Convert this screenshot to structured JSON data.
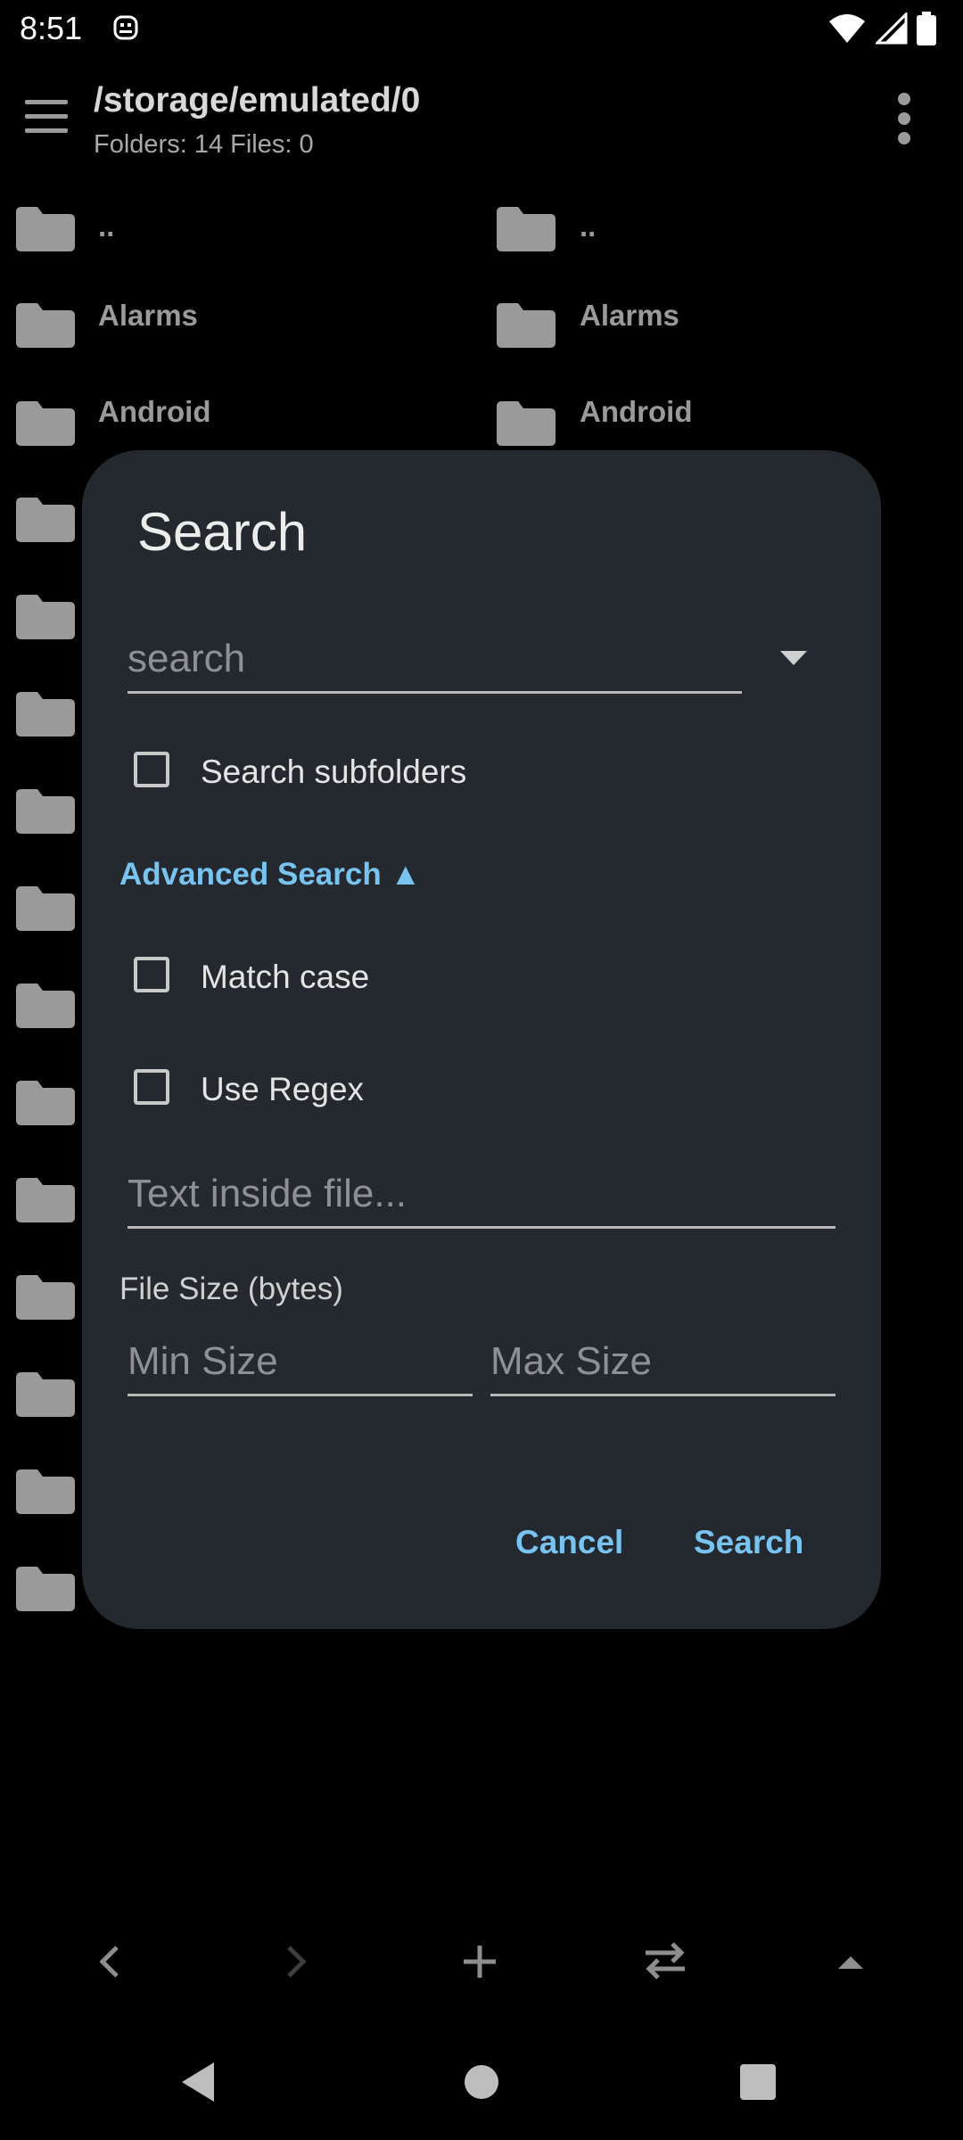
{
  "status_bar": {
    "time": "8:51",
    "icons": [
      "app-notification-icon",
      "wifi-icon",
      "signal-icon",
      "battery-icon"
    ]
  },
  "app_bar": {
    "path": "/storage/emulated/0",
    "summary": "Folders: 14 Files: 0",
    "icons": [
      "menu-icon",
      "more-vert-icon"
    ]
  },
  "file_list": {
    "rows": [
      {
        "left": "..",
        "right": ".."
      },
      {
        "left": "Alarms",
        "right": "Alarms"
      },
      {
        "left": "Android",
        "right": "Android"
      }
    ],
    "extra_folder_icons": 12
  },
  "dialog": {
    "title": "Search",
    "search_placeholder": "search",
    "search_subfolders_label": "Search subfolders",
    "search_subfolders_checked": false,
    "advanced_search_label": "Advanced Search ▲",
    "match_case_label": "Match case",
    "match_case_checked": false,
    "use_regex_label": "Use Regex",
    "use_regex_checked": false,
    "text_inside_placeholder": "Text inside file...",
    "file_size_label": "File Size (bytes)",
    "min_size_placeholder": "Min Size",
    "max_size_placeholder": "Max Size",
    "cancel_label": "Cancel",
    "search_label": "Search"
  },
  "toolbar": {
    "icons": [
      "back-arrow-icon",
      "forward-arrow-icon",
      "add-icon",
      "swap-icon",
      "up-arrow-icon"
    ]
  },
  "nav_bar": {
    "icons": [
      "nav-back-icon",
      "nav-home-icon",
      "nav-recents-icon"
    ]
  },
  "colors": {
    "background": "#000000",
    "dialog": "#24292f",
    "accent": "#79c3f0",
    "icon_gray": "#9a9a9a"
  }
}
